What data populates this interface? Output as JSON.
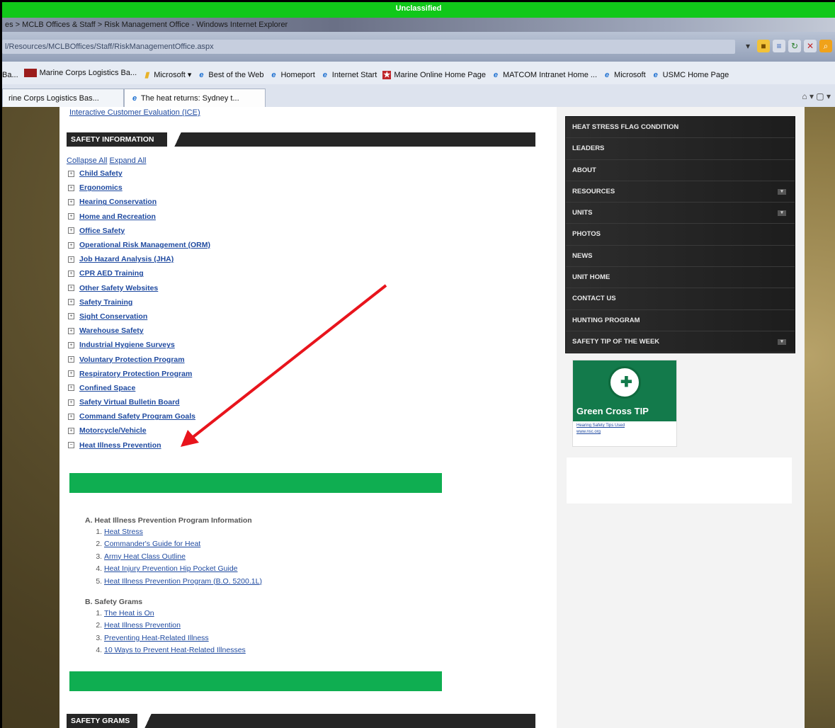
{
  "classification": "Unclassified",
  "window_title": "es > MCLB Offices & Staff > Risk Management Office - Windows Internet Explorer",
  "address_url": "l/Resources/MCLBOffices/Staff/RiskManagementOffice.aspx",
  "favorites": [
    {
      "label": "Ba..."
    },
    {
      "label": "Marine Corps Logistics Ba..."
    },
    {
      "label": "Microsoft ▾"
    },
    {
      "label": "Best of the Web"
    },
    {
      "label": "Homeport"
    },
    {
      "label": "Internet Start"
    },
    {
      "label": "Marine Online Home Page"
    },
    {
      "label": "MATCOM Intranet Home ..."
    },
    {
      "label": "Microsoft"
    },
    {
      "label": "USMC Home Page"
    }
  ],
  "tabs": [
    {
      "label": "rine Corps Logistics Bas..."
    },
    {
      "label": "The heat returns: Sydney t..."
    }
  ],
  "ice_link": "Interactive Customer Evaluation (ICE)",
  "safety_info_header": "SAFETY INFORMATION",
  "collapse_all": "Collapse All",
  "expand_all": "Expand All",
  "safety_items": [
    {
      "label": "Child Safety",
      "toggle": "+"
    },
    {
      "label": "Ergonomics",
      "toggle": "+"
    },
    {
      "label": "Hearing Conservation",
      "toggle": "+"
    },
    {
      "label": "Home and Recreation",
      "toggle": "+"
    },
    {
      "label": "Office Safety",
      "toggle": "+"
    },
    {
      "label": "Operational Risk Management (ORM)",
      "toggle": "+"
    },
    {
      "label": "Job Hazard Analysis (JHA)",
      "toggle": "+"
    },
    {
      "label": "CPR AED Training",
      "toggle": "+"
    },
    {
      "label": "Other Safety Websites",
      "toggle": "+"
    },
    {
      "label": "Safety Training",
      "toggle": "+"
    },
    {
      "label": "Sight Conservation",
      "toggle": "+"
    },
    {
      "label": "Warehouse Safety",
      "toggle": "+"
    },
    {
      "label": "Industrial Hygiene Surveys",
      "toggle": "+"
    },
    {
      "label": "Voluntary Protection Program",
      "toggle": "+"
    },
    {
      "label": "Respiratory Protection Program",
      "toggle": "+"
    },
    {
      "label": "Confined Space",
      "toggle": "+"
    },
    {
      "label": "Safety Virtual Bulletin Board",
      "toggle": "+"
    },
    {
      "label": "Command Safety Program Goals",
      "toggle": "+"
    },
    {
      "label": "Motorcycle/Vehicle",
      "toggle": "+"
    },
    {
      "label": "Heat Illness Prevention",
      "toggle": "−"
    }
  ],
  "program_heading": "A.  Heat Illness Prevention Program Information",
  "program_links": [
    "Heat Stress",
    "Commander's Guide for Heat",
    "Army Heat Class Outline",
    "Heat Injury Prevention Hip Pocket Guide",
    "Heat Illness Prevention Program (B.O. 5200.1L)"
  ],
  "grams_heading": "B.  Safety Grams",
  "grams_links": [
    "The Heat is On",
    "Heat Illness Prevention",
    "Preventing Heat-Related Illness",
    "10 Ways to Prevent Heat-Related Illnesses"
  ],
  "safety_grams_header": "SAFETY GRAMS",
  "nav_menu": [
    {
      "label": "HEAT STRESS FLAG CONDITION",
      "expand": ""
    },
    {
      "label": "LEADERS",
      "expand": ""
    },
    {
      "label": "ABOUT",
      "expand": ""
    },
    {
      "label": "RESOURCES",
      "expand": "▾"
    },
    {
      "label": "UNITS",
      "expand": "▾"
    },
    {
      "label": "PHOTOS",
      "expand": ""
    },
    {
      "label": "NEWS",
      "expand": ""
    },
    {
      "label": "UNIT HOME",
      "expand": ""
    },
    {
      "label": "CONTACT US",
      "expand": ""
    },
    {
      "label": "HUNTING PROGRAM",
      "expand": ""
    },
    {
      "label": "SAFETY TIP OF THE WEEK",
      "expand": "▾"
    }
  ],
  "green_cross": {
    "title_1": "Green Cross ",
    "title_2": "TIP",
    "caption_1": "Hearing Safety Tips Used",
    "caption_2": "www.nsc.org"
  },
  "arrow_color": "#e8141c"
}
